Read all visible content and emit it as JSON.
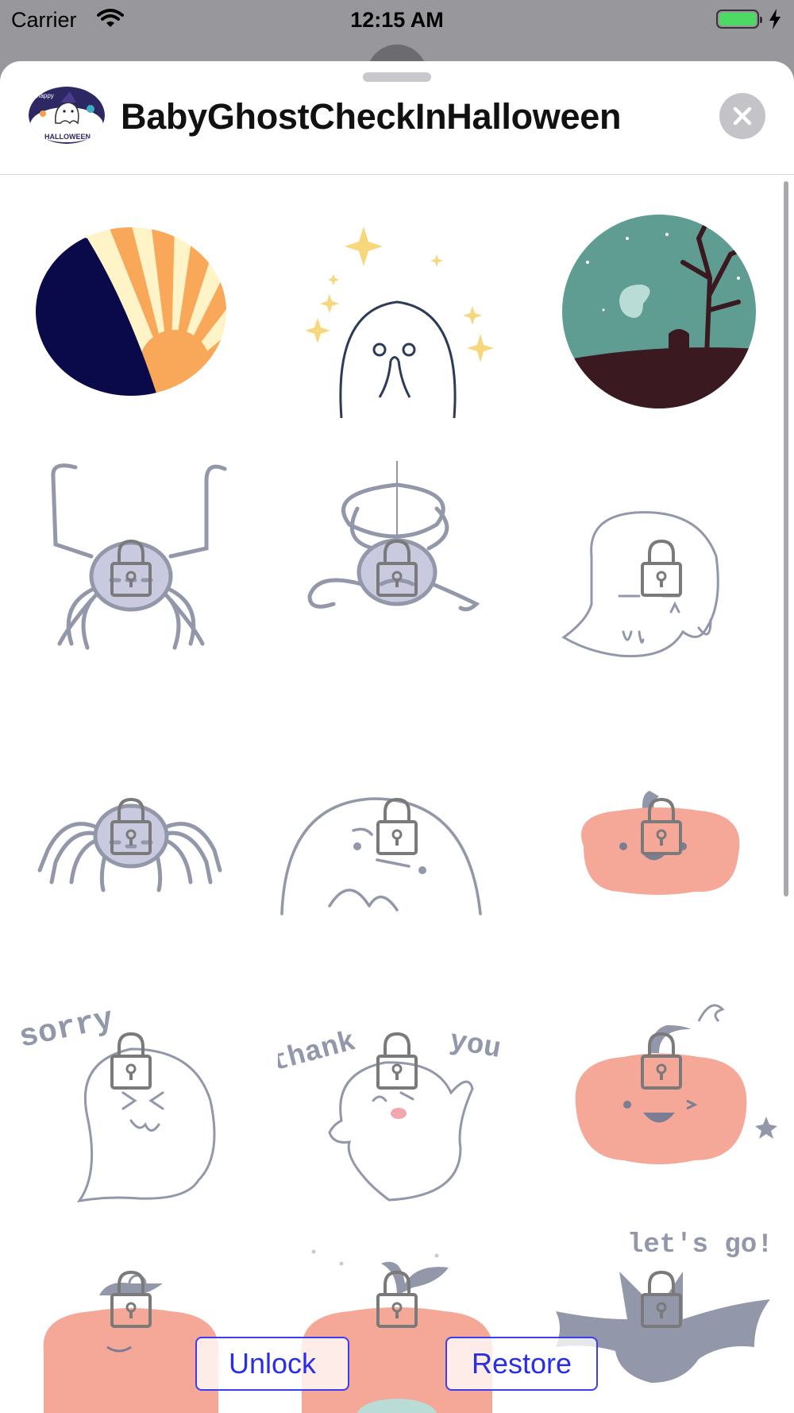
{
  "status_bar": {
    "carrier": "Carrier",
    "time": "12:15 AM",
    "battery_color": "#4cd964"
  },
  "header": {
    "app_icon_text_top": "happy",
    "app_icon_text_bottom": "HALLOWEEN",
    "title": "BabyGhostCheckInHalloween",
    "close_icon": "close-icon"
  },
  "stickers": [
    {
      "name": "sunrise",
      "locked": false
    },
    {
      "name": "sparkle-ghost",
      "locked": false
    },
    {
      "name": "night-graveyard",
      "locked": false
    },
    {
      "name": "spider-legs-up",
      "locked": true
    },
    {
      "name": "spider-web",
      "locked": true
    },
    {
      "name": "ghost-wink",
      "locked": true
    },
    {
      "name": "spider-sleep",
      "locked": true
    },
    {
      "name": "ghost-big-face",
      "locked": true
    },
    {
      "name": "pumpkin-small",
      "locked": true
    },
    {
      "name": "sorry-ghost",
      "locked": true,
      "text": "sorry"
    },
    {
      "name": "thank-you-ghost",
      "locked": true,
      "text_left": "thank",
      "text_right": "you"
    },
    {
      "name": "pumpkin-wink",
      "locked": true
    },
    {
      "name": "pumpkin-bottom-1",
      "locked": true
    },
    {
      "name": "pumpkin-bottom-2",
      "locked": true
    },
    {
      "name": "bat-lets-go",
      "locked": true,
      "text": "let's go!"
    }
  ],
  "buttons": {
    "unlock": "Unlock",
    "restore": "Restore"
  },
  "colors": {
    "accent": "#2a2ee6",
    "line": "#9397aa",
    "pumpkin": "#f5a898",
    "navy": "#0a0a4a",
    "teal": "#5f9d93",
    "sun": "#f9a85a"
  }
}
